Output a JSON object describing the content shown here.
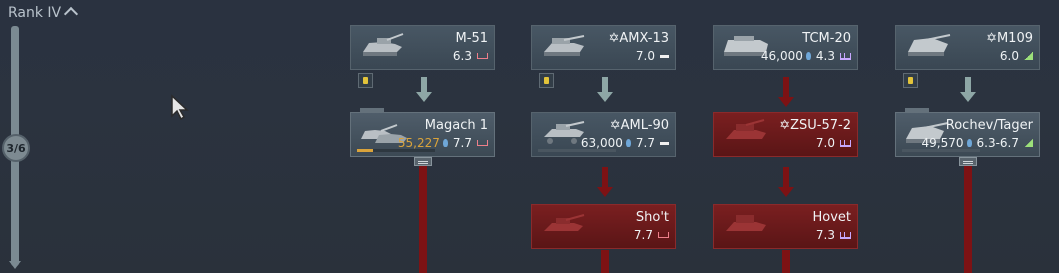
{
  "rank": {
    "title": "Rank IV",
    "progress_label": "3/6"
  },
  "vehicles": [
    {
      "id": "m51",
      "name": "M-51",
      "rp": "",
      "br": "6.3",
      "role": "tank-destroyer-red",
      "state": "owned",
      "premium": true
    },
    {
      "id": "amx13",
      "name": "✡AMX-13",
      "rp": "",
      "br": "7.0",
      "role": "light-tank-white",
      "state": "owned",
      "premium": true
    },
    {
      "id": "tcm20",
      "name": "TCM-20",
      "rp": "46,000",
      "br": "4.3",
      "role": "spaa-purple",
      "state": "owned",
      "premium": false
    },
    {
      "id": "m109",
      "name": "✡M109",
      "rp": "",
      "br": "6.0",
      "role": "spg-green",
      "state": "owned",
      "premium": true
    },
    {
      "id": "magach1",
      "name": "Magach 1",
      "rp": "55,227",
      "rp_color": "gold",
      "br": "7.7",
      "role": "tank-destroyer-red",
      "state": "researching",
      "premium": false,
      "progress_fraction": 0.2
    },
    {
      "id": "aml90",
      "name": "✡AML-90",
      "rp": "63,000",
      "br": "7.7",
      "role": "light-tank-white",
      "state": "researchable",
      "premium": false
    },
    {
      "id": "zsu572",
      "name": "✡ZSU-57-2",
      "rp": "",
      "br": "7.0",
      "role": "spaa-purple",
      "state": "locked",
      "premium": false
    },
    {
      "id": "rochev",
      "name": "Rochev/Tager",
      "rp": "49,570",
      "br": "6.3-6.7",
      "role": "spg-green",
      "state": "researchable",
      "premium": false
    },
    {
      "id": "shot",
      "name": "Sho't",
      "rp": "",
      "br": "7.7",
      "role": "tank-destroyer-red",
      "state": "locked",
      "premium": false
    },
    {
      "id": "hovet",
      "name": "Hovet",
      "rp": "",
      "br": "7.3",
      "role": "spaa-purple",
      "state": "locked",
      "premium": false
    }
  ],
  "colors": {
    "background": "#2a3240",
    "card": "#3f4d59",
    "locked_card": "#6a1a1b",
    "research_gold": "#d9a33b",
    "rp_icon": "#6fa7d8",
    "locked_line": "#7d1214",
    "unlocked_arrow": "#8ea7a6"
  },
  "icons": {
    "premium": "premium-badge-icon",
    "research_points": "research-bulb-icon",
    "cursor": "mouse-pointer-icon"
  }
}
